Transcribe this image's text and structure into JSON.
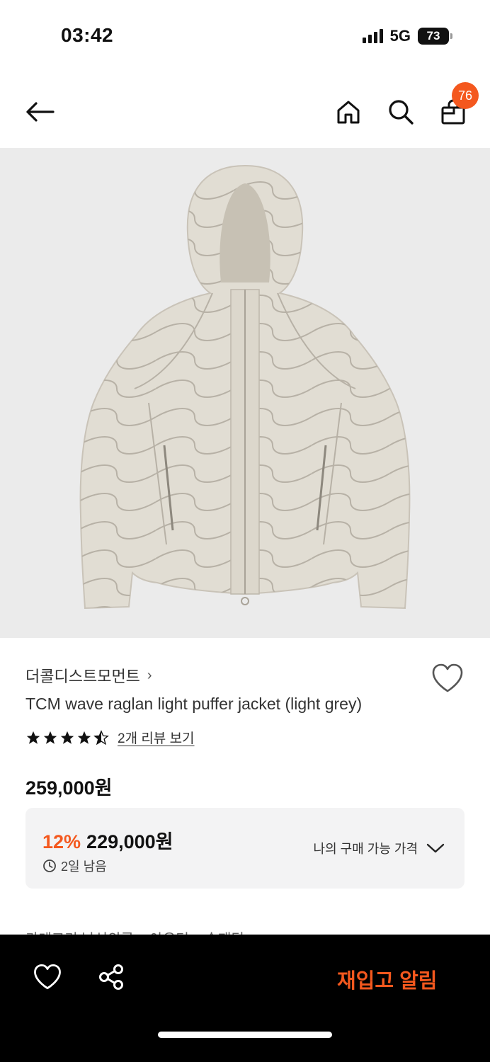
{
  "status_bar": {
    "time": "03:42",
    "network": "5G",
    "battery": "73"
  },
  "nav": {
    "cart_count": "76"
  },
  "product": {
    "brand": "더콜디스트모먼트",
    "title": "TCM wave raglan light puffer jacket (light grey)",
    "rating": 4.5,
    "review_link": "2개 리뷰 보기",
    "price": "259,000원",
    "deal": {
      "discount": "12%",
      "price": "229,000원",
      "time_left": "2일 남음",
      "my_price_label": "나의 구매 가능 가격"
    },
    "category_peek": "카테고리        남성의류 > 아우터 > 숏패딩"
  },
  "bottom_bar": {
    "restock_label": "재입고 알림"
  },
  "colors": {
    "accent": "#f4581e",
    "image_bg": "#ebebeb",
    "jacket": "#e1ddd3"
  },
  "icons": [
    "back-arrow-icon",
    "home-icon",
    "search-icon",
    "shopping-bag-icon",
    "heart-icon",
    "star-icon",
    "clock-icon",
    "chevron-down-icon",
    "share-icon"
  ]
}
